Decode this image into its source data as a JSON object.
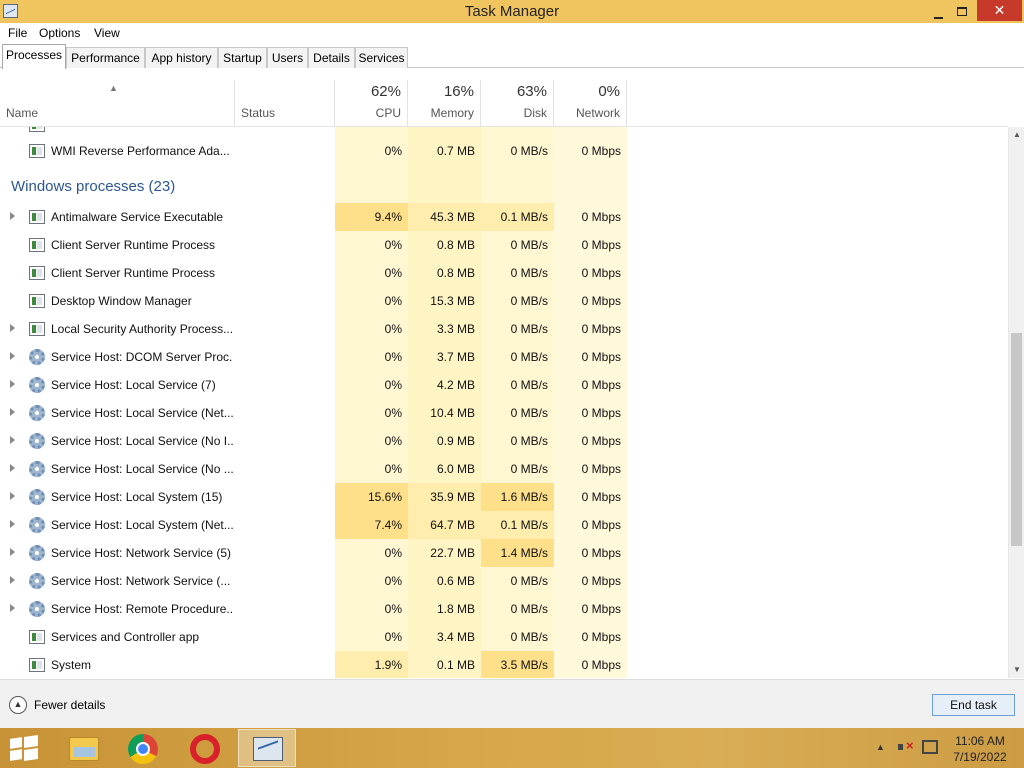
{
  "window": {
    "title": "Task Manager",
    "minimize_glyph": "",
    "close_glyph": "✕"
  },
  "menu": {
    "items": [
      "File",
      "Options",
      "View"
    ]
  },
  "tabs": [
    "Processes",
    "Performance",
    "App history",
    "Startup",
    "Users",
    "Details",
    "Services"
  ],
  "columns": {
    "name": "Name",
    "status": "Status",
    "cpu": {
      "percent": "62%",
      "label": "CPU"
    },
    "memory": {
      "percent": "16%",
      "label": "Memory"
    },
    "disk": {
      "percent": "63%",
      "label": "Disk"
    },
    "network": {
      "percent": "0%",
      "label": "Network"
    }
  },
  "group": {
    "title": "Windows processes (23)"
  },
  "rows": [
    {
      "name": "WMI Reverse Performance Ada...",
      "icon": "process-icon",
      "expandable": false,
      "cpu": "0%",
      "memory": "0.7 MB",
      "disk": "0 MB/s",
      "network": "0 Mbps"
    },
    {
      "name": "Antimalware Service Executable",
      "icon": "process-icon",
      "expandable": true,
      "cpu": "9.4%",
      "memory": "45.3 MB",
      "disk": "0.1 MB/s",
      "network": "0 Mbps"
    },
    {
      "name": "Client Server Runtime Process",
      "icon": "process-icon",
      "expandable": false,
      "cpu": "0%",
      "memory": "0.8 MB",
      "disk": "0 MB/s",
      "network": "0 Mbps"
    },
    {
      "name": "Client Server Runtime Process",
      "icon": "process-icon",
      "expandable": false,
      "cpu": "0%",
      "memory": "0.8 MB",
      "disk": "0 MB/s",
      "network": "0 Mbps"
    },
    {
      "name": "Desktop Window Manager",
      "icon": "process-icon",
      "expandable": false,
      "cpu": "0%",
      "memory": "15.3 MB",
      "disk": "0 MB/s",
      "network": "0 Mbps"
    },
    {
      "name": "Local Security Authority Process...",
      "icon": "process-icon",
      "expandable": true,
      "cpu": "0%",
      "memory": "3.3 MB",
      "disk": "0 MB/s",
      "network": "0 Mbps"
    },
    {
      "name": "Service Host: DCOM Server Proc...",
      "icon": "gear-icon",
      "expandable": true,
      "cpu": "0%",
      "memory": "3.7 MB",
      "disk": "0 MB/s",
      "network": "0 Mbps"
    },
    {
      "name": "Service Host: Local Service (7)",
      "icon": "gear-icon",
      "expandable": true,
      "cpu": "0%",
      "memory": "4.2 MB",
      "disk": "0 MB/s",
      "network": "0 Mbps"
    },
    {
      "name": "Service Host: Local Service (Net...",
      "icon": "gear-icon",
      "expandable": true,
      "cpu": "0%",
      "memory": "10.4 MB",
      "disk": "0 MB/s",
      "network": "0 Mbps"
    },
    {
      "name": "Service Host: Local Service (No I...",
      "icon": "gear-icon",
      "expandable": true,
      "cpu": "0%",
      "memory": "0.9 MB",
      "disk": "0 MB/s",
      "network": "0 Mbps"
    },
    {
      "name": "Service Host: Local Service (No ...",
      "icon": "gear-icon",
      "expandable": true,
      "cpu": "0%",
      "memory": "6.0 MB",
      "disk": "0 MB/s",
      "network": "0 Mbps"
    },
    {
      "name": "Service Host: Local System (15)",
      "icon": "gear-icon",
      "expandable": true,
      "cpu": "15.6%",
      "memory": "35.9 MB",
      "disk": "1.6 MB/s",
      "network": "0 Mbps"
    },
    {
      "name": "Service Host: Local System (Net...",
      "icon": "gear-icon",
      "expandable": true,
      "cpu": "7.4%",
      "memory": "64.7 MB",
      "disk": "0.1 MB/s",
      "network": "0 Mbps"
    },
    {
      "name": "Service Host: Network Service (5)",
      "icon": "gear-icon",
      "expandable": true,
      "cpu": "0%",
      "memory": "22.7 MB",
      "disk": "1.4 MB/s",
      "network": "0 Mbps"
    },
    {
      "name": "Service Host: Network Service (...",
      "icon": "gear-icon",
      "expandable": true,
      "cpu": "0%",
      "memory": "0.6 MB",
      "disk": "0 MB/s",
      "network": "0 Mbps"
    },
    {
      "name": "Service Host: Remote Procedure...",
      "icon": "gear-icon",
      "expandable": true,
      "cpu": "0%",
      "memory": "1.8 MB",
      "disk": "0 MB/s",
      "network": "0 Mbps"
    },
    {
      "name": "Services and Controller app",
      "icon": "process-icon",
      "expandable": false,
      "cpu": "0%",
      "memory": "3.4 MB",
      "disk": "0 MB/s",
      "network": "0 Mbps"
    },
    {
      "name": "System",
      "icon": "process-icon",
      "expandable": false,
      "cpu": "1.9%",
      "memory": "0.1 MB",
      "disk": "3.5 MB/s",
      "network": "0 Mbps"
    }
  ],
  "scroll": {
    "position": 0.62,
    "visible_fraction": 0.41
  },
  "footer": {
    "fewer_details": "Fewer details",
    "end_task": "End task"
  },
  "taskbar": {
    "items": [
      "start-icon",
      "file-explorer-icon",
      "chrome-icon",
      "opera-icon",
      "task-manager-icon"
    ],
    "time": "11:06 AM",
    "date": "7/19/2022"
  },
  "colors": {
    "title_bar": "#f0c560",
    "heat_light": "#fff7d1",
    "heat_medium": "#ffedad",
    "heat_strong": "#ffe08a",
    "group_title": "#2b5797",
    "close_button": "#c7392b"
  }
}
